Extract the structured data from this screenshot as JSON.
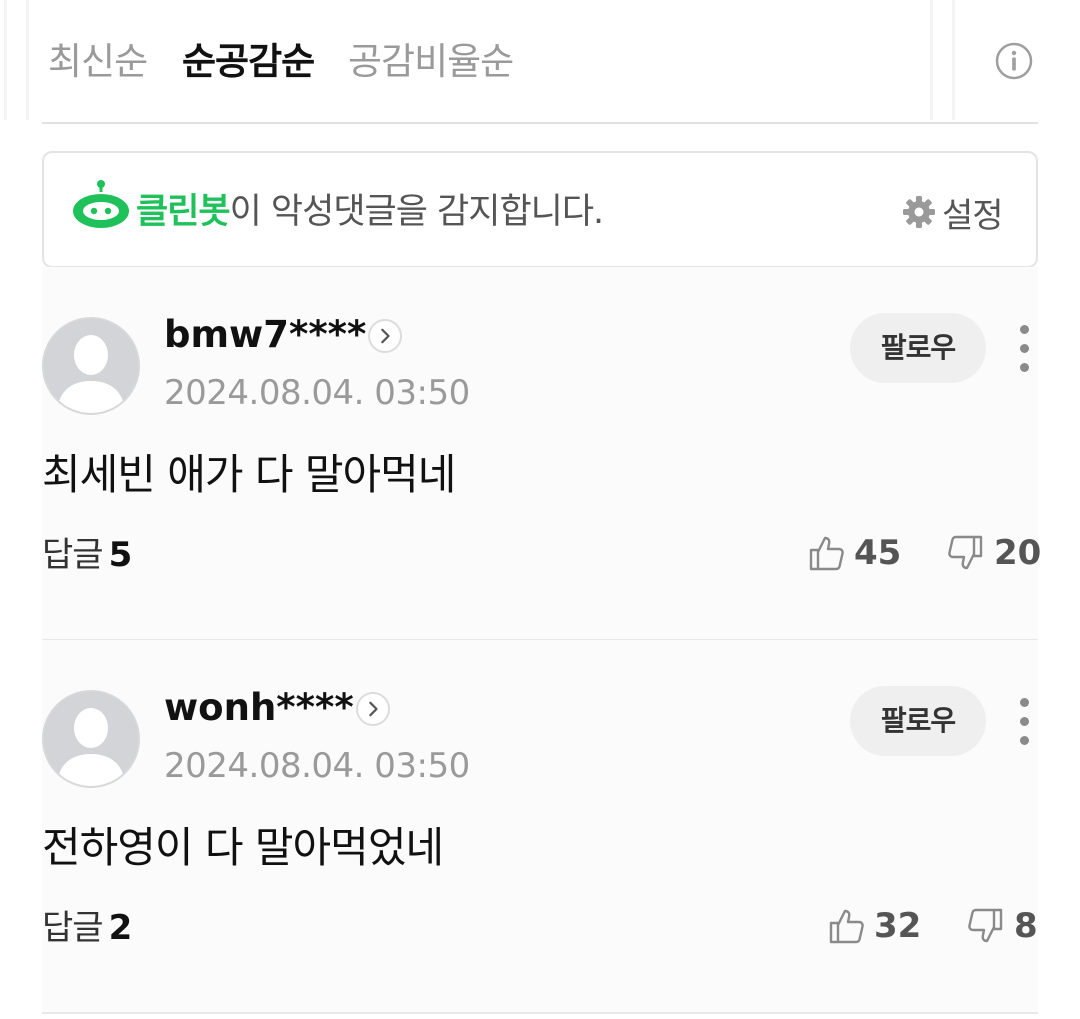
{
  "sort_tabs": [
    {
      "label": "최신순",
      "active": false
    },
    {
      "label": "순공감순",
      "active": true
    },
    {
      "label": "공감비율순",
      "active": false
    }
  ],
  "cleanbot": {
    "name": "클린봇",
    "message": "이 악성댓글을 감지합니다.",
    "settings_label": "설정",
    "accent_color": "#1fc15a"
  },
  "comments": [
    {
      "username": "bmw7****",
      "timestamp": "2024.08.04. 03:50",
      "follow_label": "팔로우",
      "body": "최세빈 애가 다 말아먹네",
      "reply_label": "답글",
      "reply_count": "5",
      "likes": "45",
      "dislikes": "20"
    },
    {
      "username": "wonh****",
      "timestamp": "2024.08.04. 03:50",
      "follow_label": "팔로우",
      "body": "전하영이 다 말아먹었네",
      "reply_label": "답글",
      "reply_count": "2",
      "likes": "32",
      "dislikes": "8"
    }
  ],
  "icons": {
    "info": "info-icon",
    "cleanbot": "robot-icon",
    "settings": "gear-icon",
    "chevron": "chevron-right-icon",
    "more": "more-vertical-icon",
    "like": "thumbs-up-icon",
    "dislike": "thumbs-down-icon",
    "avatar": "default-avatar-icon"
  }
}
